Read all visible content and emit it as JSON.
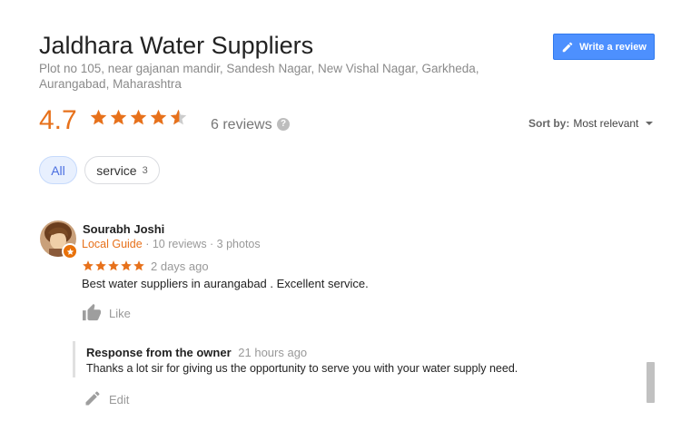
{
  "business": {
    "name": "Jaldhara Water Suppliers",
    "address": "Plot no 105, near gajanan mandir, Sandesh Nagar, New Vishal Nagar, Garkheda, Aurangabad, Maharashtra",
    "write_review_label": "Write a review"
  },
  "rating": {
    "score": "4.7",
    "stars_filled": 4.7,
    "review_count": "6 reviews",
    "help_icon_glyph": "?"
  },
  "sort": {
    "label": "Sort by:",
    "value": "Most relevant"
  },
  "filters": [
    {
      "label": "All",
      "selected": true
    },
    {
      "label": "service",
      "count": "3",
      "selected": false
    }
  ],
  "reviews": [
    {
      "name": "Sourabh Joshi",
      "badge": "Local Guide",
      "meta": " · 10 reviews · 3 photos",
      "stars": 5,
      "date": "2 days ago",
      "text": "Best water suppliers in aurangabad . Excellent service.",
      "like_label": "Like",
      "response": {
        "label": "Response from the owner",
        "time": "21 hours ago",
        "text": "Thanks a lot sir for giving us the opportunity to serve you with your water supply need."
      },
      "edit_label": "Edit"
    }
  ],
  "colors": {
    "star": "#e7711b",
    "button": "#4d90fe",
    "chip_selected_bg": "#e8f0fe",
    "muted_text": "#999999"
  },
  "icons": {
    "write_review": "pencil-icon",
    "help": "help-circle-icon",
    "sort": "chevron-down-icon",
    "like": "thumbs-up-icon",
    "edit": "pencil-icon",
    "local_guide": "local-guide-star-icon"
  }
}
